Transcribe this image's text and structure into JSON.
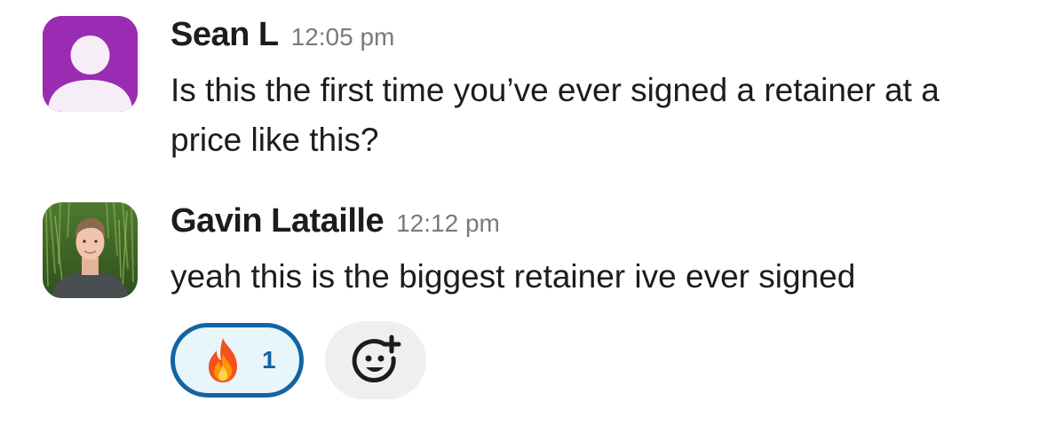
{
  "messages": [
    {
      "author": "Sean L",
      "time": "12:05 pm",
      "text": "Is this the first time you’ve ever signed a retainer at a price like this?",
      "avatar": "default-user-icon",
      "avatar_color": "#9a2bb3"
    },
    {
      "author": "Gavin Lataille",
      "time": "12:12 pm",
      "text": "yeah this is the biggest retainer ive ever signed",
      "avatar": "profile-photo",
      "reactions": [
        {
          "emoji": "fire-emoji",
          "count": "1"
        }
      ],
      "add_reaction_icon": "add-reaction-icon"
    }
  ],
  "colors": {
    "reaction_border": "#1264a3",
    "reaction_bg": "#e8f5fa",
    "timestamp": "#7b7a7b"
  }
}
